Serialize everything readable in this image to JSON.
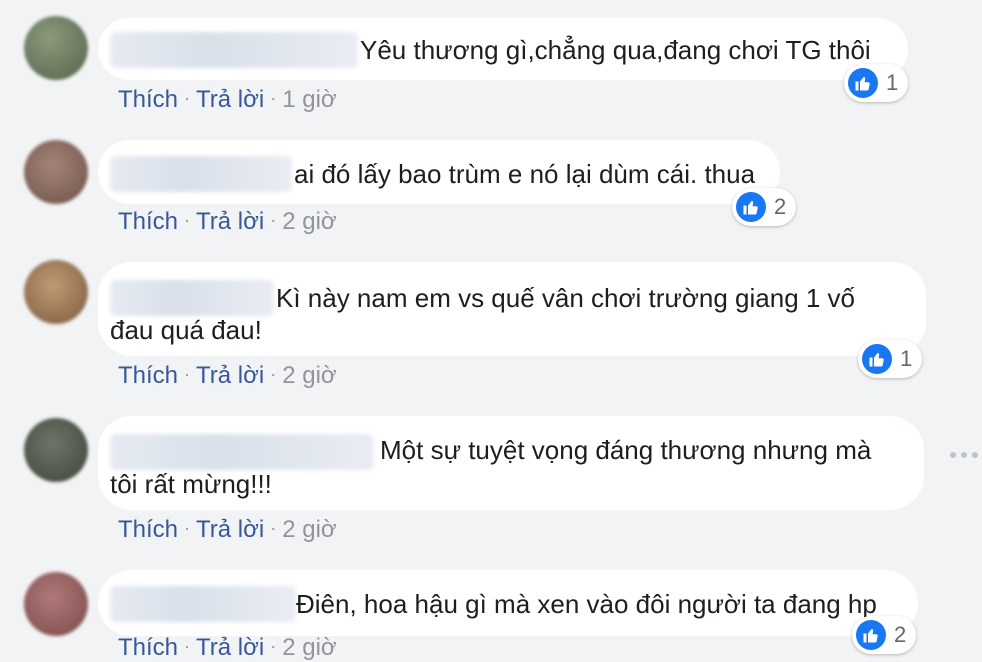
{
  "comments": [
    {
      "text_lines": [
        "Yêu thương gì,chẳng qua,đang chơi TG thôi"
      ],
      "reaction_count": "1",
      "like_label": "Thích",
      "reply_label": "Trả lời",
      "separator": "·",
      "time": "1 giờ"
    },
    {
      "text_lines": [
        "ai đó lấy bao trùm e nó lại dùm cái. thua"
      ],
      "reaction_count": "2",
      "like_label": "Thích",
      "reply_label": "Trả lời",
      "separator": "·",
      "time": "2 giờ"
    },
    {
      "text_lines": [
        "Kì này nam em vs quế vân chơi trường giang 1 vố",
        "đau quá đau!"
      ],
      "reaction_count": "1",
      "like_label": "Thích",
      "reply_label": "Trả lời",
      "separator": "·",
      "time": "2 giờ"
    },
    {
      "text_lines": [
        "Một sự tuyệt vọng đáng thương nhưng mà",
        "tôi rất mừng!!!"
      ],
      "reaction_count": "",
      "like_label": "Thích",
      "reply_label": "Trả lời",
      "separator": "·",
      "time": "2 giờ"
    },
    {
      "text_lines": [
        "Điên, hoa hậu gì mà xen vào đôi người ta đang hp"
      ],
      "reaction_count": "2",
      "like_label": "Thích",
      "reply_label": "Trả lời",
      "separator": "·",
      "time": "2 giờ"
    }
  ],
  "colors": {
    "background": "#f2f3f5",
    "bubble": "#ffffff",
    "link": "#385898",
    "like_blue": "#1877f2",
    "meta_gray": "#90949c"
  }
}
